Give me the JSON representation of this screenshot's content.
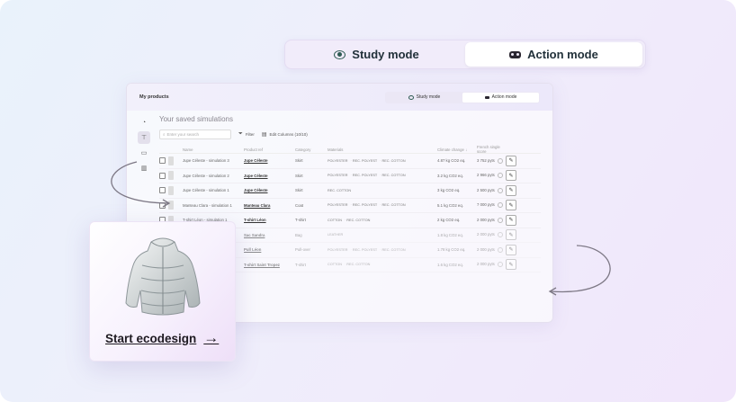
{
  "modes": {
    "study": "Study mode",
    "action": "Action mode",
    "active": "action"
  },
  "app": {
    "title": "My products",
    "modes": {
      "study": "Study mode",
      "action": "Action mode"
    },
    "section_title": "Your saved simulations",
    "search_placeholder": "Enter your search",
    "filter_label": "Filter",
    "edit_columns_label": "Edit Columns (10/10)",
    "columns": [
      "Name",
      "Product ref",
      "Category",
      "Materials",
      "Climate change",
      "French single score"
    ],
    "rows": [
      {
        "name": "Jupe Céleste - simulation 3",
        "ref": "Jupe Céleste",
        "category": "Skirt",
        "materials": [
          "POLYESTER",
          "REC. POLYEST",
          "REC. COTTON"
        ],
        "climate": "4.87 kg CO2 eq.",
        "score": "3 752 pyts"
      },
      {
        "name": "Jupe Céleste - simulation 2",
        "ref": "Jupe Céleste",
        "category": "Skirt",
        "materials": [
          "POLYESTER",
          "REC. POLYEST",
          "REC. COTTON"
        ],
        "climate": "3.2 kg CO2 eq.",
        "score": "2 966 pyts"
      },
      {
        "name": "Jupe Céleste - simulation 1",
        "ref": "Jupe Céleste",
        "category": "Skirt",
        "materials": [
          "REC. COTTON"
        ],
        "climate": "3 kg CO2 eq.",
        "score": "2 500 pyts"
      },
      {
        "name": "Manteau Clara - simulation 1",
        "ref": "Manteau Clara",
        "category": "Coat",
        "materials": [
          "POLYESTER",
          "REC. POLYEST",
          "REC. COTTON"
        ],
        "climate": "5.1 kg CO2 eq.",
        "score": "7 000 pyts"
      },
      {
        "name": "T-shirt Léon - simulation 1",
        "ref": "T-shirt Léon",
        "category": "T-shirt",
        "materials": [
          "COTTON",
          "REC. COTTON"
        ],
        "climate": "2 kg CO2 eq.",
        "score": "2 000 pyts"
      },
      {
        "name": "",
        "ref": "Sac Sandra",
        "category": "Bag",
        "materials": [
          "LEATHER"
        ],
        "climate": "1.8 kg CO2 eq.",
        "score": "2 000 pyts"
      },
      {
        "name": "",
        "ref": "Pull Léon",
        "category": "Pull-over",
        "materials": [
          "POLYESTER",
          "REC. POLYEST",
          "REC. COTTON"
        ],
        "climate": "1.78 kg CO2 eq.",
        "score": "2 000 pyts"
      },
      {
        "name": "",
        "ref": "T-shirt Saint Tropez",
        "category": "T-shirt",
        "materials": [
          "COTTON",
          "REC. COTTON"
        ],
        "climate": "1.6 kg CO2 eq.",
        "score": "2 000 pyts"
      }
    ]
  },
  "card": {
    "cta": "Start ecodesign",
    "image": "puffer-jacket-icon"
  },
  "colors": {
    "accent_dark": "#2d5a52",
    "background_start": "#e9f2fb",
    "background_end": "#f1e6fb"
  }
}
